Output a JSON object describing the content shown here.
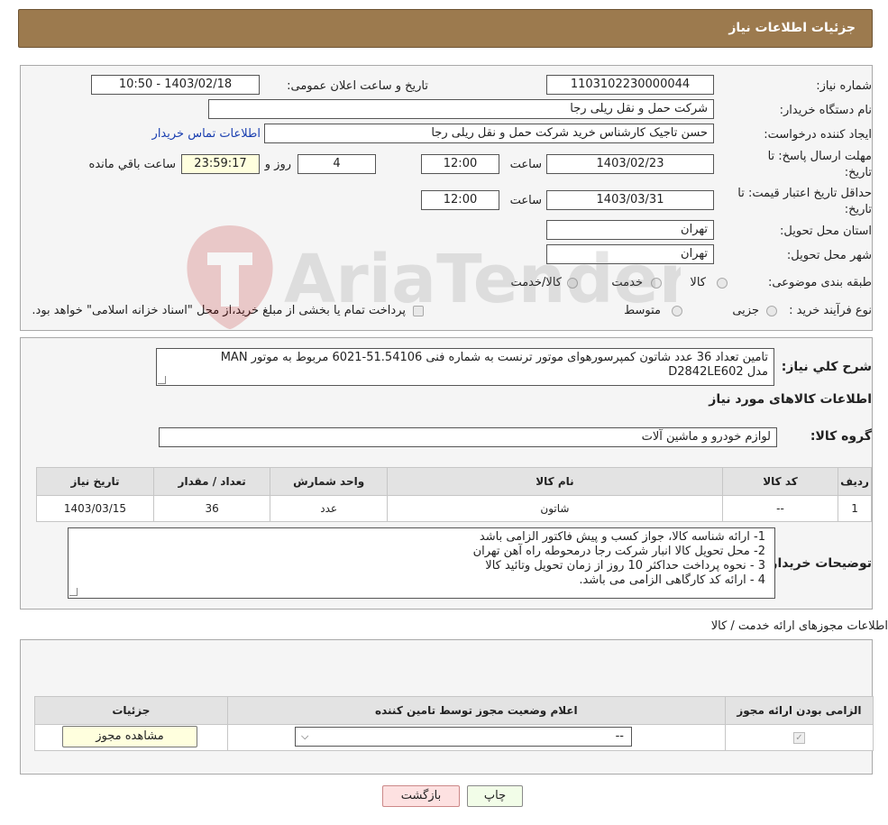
{
  "header": {
    "title": "جزئیات اطلاعات نیاز"
  },
  "form": {
    "need_number_label": "شماره نیاز:",
    "need_number": "1103102230000044",
    "announce_label": "تاریخ و ساعت اعلان عمومی:",
    "announce_value": "1403/02/18 - 10:50",
    "buyer_org_label": "نام دستگاه خریدار:",
    "buyer_org": "شرکت حمل و نقل ریلی رجا",
    "creator_label": "ایجاد کننده درخواست:",
    "creator": "حسن تاجیک کارشناس خرید شرکت حمل و نقل ریلی رجا",
    "buyer_contact_link": "اطلاعات تماس خریدار",
    "deadline_label_1": "مهلت ارسال پاسخ: تا",
    "deadline_label_2": "تاریخ:",
    "deadline_date": "1403/02/23",
    "time_label": "ساعت",
    "deadline_time": "12:00",
    "days_value": "4",
    "days_label": "روز و",
    "remaining_time": "23:59:17",
    "remaining_label": "ساعت باقي مانده",
    "validity_label_1": "حداقل تاریخ اعتبار قیمت: تا",
    "validity_label_2": "تاریخ:",
    "validity_date": "1403/03/31",
    "validity_time": "12:00",
    "province_label": "استان محل تحویل:",
    "province": "تهران",
    "city_label": "شهر محل تحویل:",
    "city": "تهران",
    "category_label": "طبقه بندی موضوعی:",
    "category_options": [
      "کالا",
      "خدمت",
      "کالا/خدمت"
    ],
    "process_label": "نوع فرآیند خرید :",
    "process_options": [
      "جزیی",
      "متوسط"
    ],
    "process_note": "پرداخت تمام یا بخشی از مبلغ خرید،از محل \"اسناد خزانه اسلامی\" خواهد بود."
  },
  "summary": {
    "label": "شرح کلي نیاز:",
    "text_line1": "تامین تعداد 36 عدد شاتون کمپرسورهوای موتور ترنست به شماره فنی  51.54106-6021 مربوط به موتور MAN",
    "text_line2": "مدل D2842LE602",
    "goods_info_title": "اطلاعات کالاهای مورد نیاز",
    "goods_group_label": "گروه کالا:",
    "goods_group": "لوازم خودرو و ماشین آلات"
  },
  "goods_table": {
    "headers": [
      "ردیف",
      "کد کالا",
      "نام کالا",
      "واحد شمارش",
      "تعداد / مقدار",
      "تاریخ نیاز"
    ],
    "rows": [
      [
        "1",
        "--",
        "شاتون",
        "عدد",
        "36",
        "1403/03/15"
      ]
    ]
  },
  "buyer_notes": {
    "label": "توضیحات خریدار:",
    "lines": [
      "1- ارائه شناسه کالا، جواز کسب و پیش فاکتور الزامی باشد",
      "2- محل تحویل کالا انبار شرکت رجا درمحوطه راه آهن تهران",
      "3 - نحوه پرداخت حداکثر 10 روز از زمان تحویل وتائید کالا",
      "4 - ارائه کد کارگاهی الزامی می باشد."
    ]
  },
  "permits": {
    "section_title": "اطلاعات مجوزهای ارائه خدمت / کالا",
    "headers": [
      "الزامی بودن ارائه مجوز",
      "اعلام وضعیت مجوز توسط تامین کننده",
      "جزئیات"
    ],
    "select_value": "--",
    "view_button": "مشاهده مجوز"
  },
  "buttons": {
    "print": "چاپ",
    "back": "بازگشت"
  },
  "watermark": {
    "text": "AriaTender.neT"
  }
}
